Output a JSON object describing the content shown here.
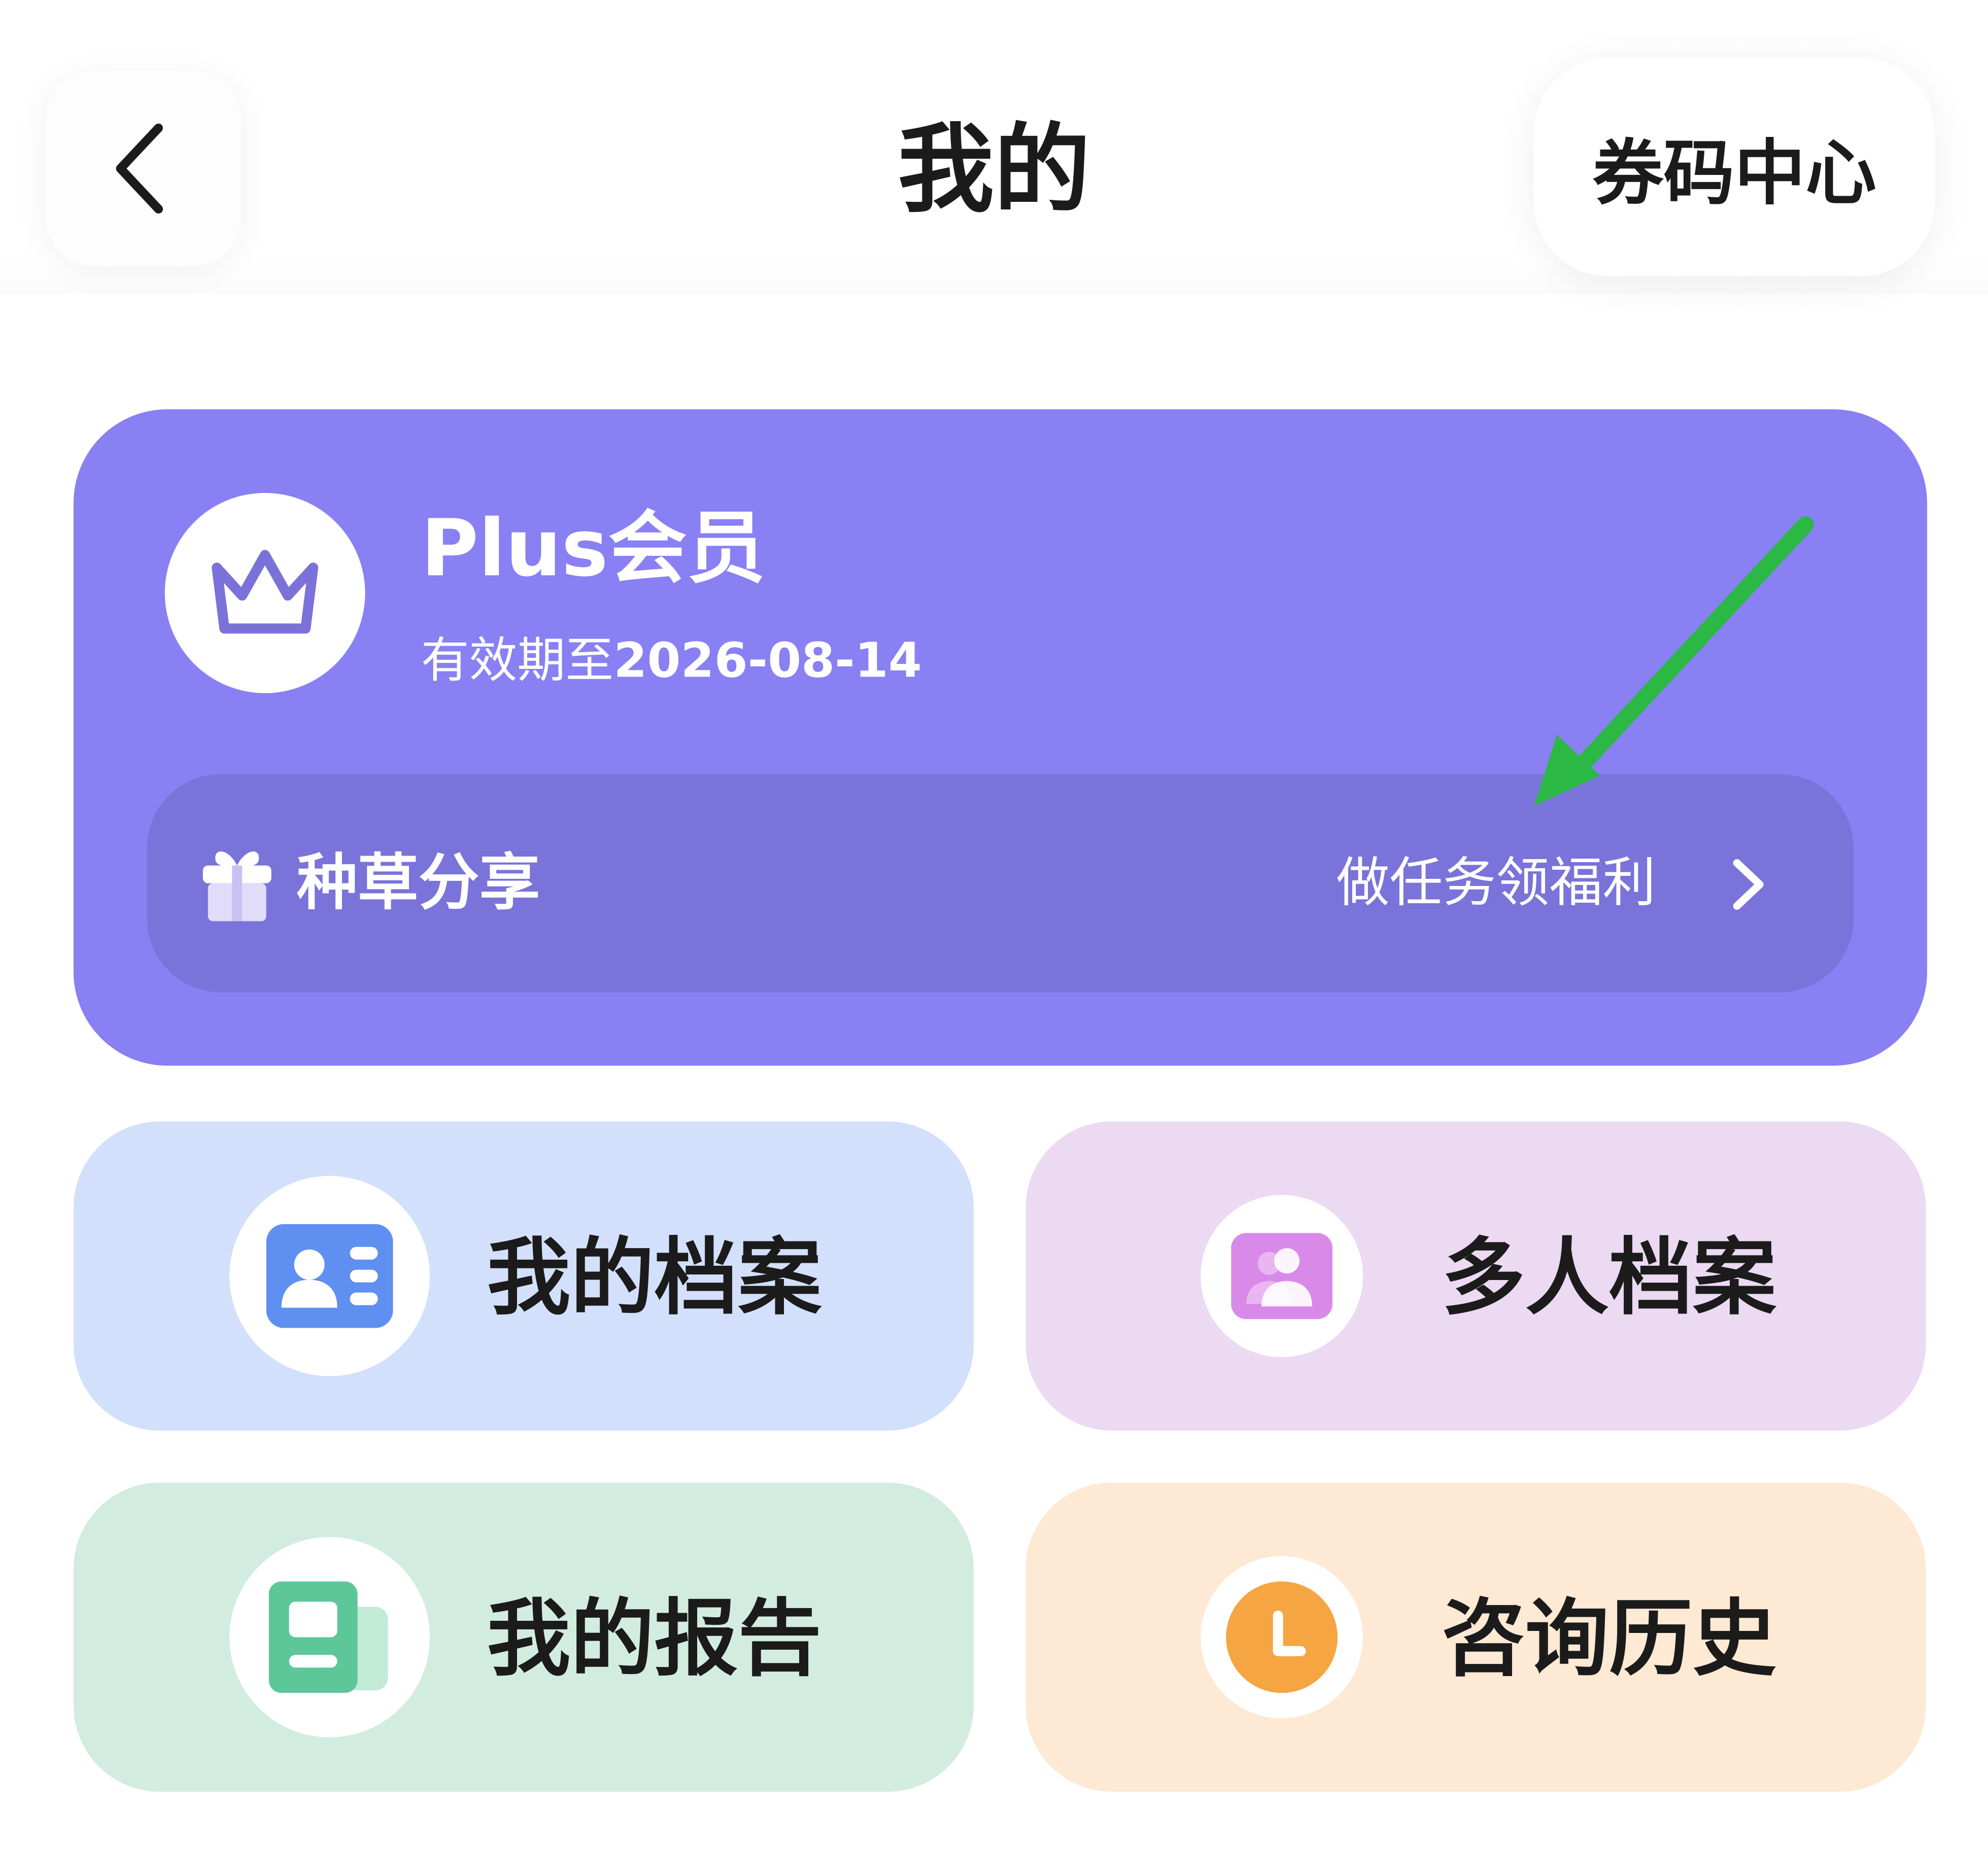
{
  "header": {
    "title": "我的",
    "coupon_center": "券码中心",
    "back_icon": "chevron-left-icon"
  },
  "membership": {
    "title": "Plus会员",
    "expiry_prefix": "有效期至",
    "expiry_date": "2026-08-14",
    "crown_icon": "crown-icon",
    "share": {
      "label": "种草分享",
      "action": "做任务领福利",
      "gift_icon": "gift-icon",
      "chevron_icon": "chevron-right-icon"
    }
  },
  "tiles": [
    {
      "id": "my-profile",
      "label": "我的档案",
      "icon": "id-card-icon",
      "color": "#5f8ff0",
      "bg": "#d3e0fb"
    },
    {
      "id": "multi-profile",
      "label": "多人档案",
      "icon": "group-icon",
      "color": "#d98ae8",
      "bg": "#ecd9f2"
    },
    {
      "id": "my-report",
      "label": "我的报告",
      "icon": "report-icon",
      "color": "#5ec79a",
      "bg": "#d3ece0"
    },
    {
      "id": "consult-history",
      "label": "咨询历史",
      "icon": "clock-icon",
      "color": "#f5a541",
      "bg": "#fde9d4"
    }
  ],
  "colors": {
    "member_card": "#8880f3",
    "share_bar": "#7a73da",
    "annotation_arrow": "#2bb844"
  }
}
